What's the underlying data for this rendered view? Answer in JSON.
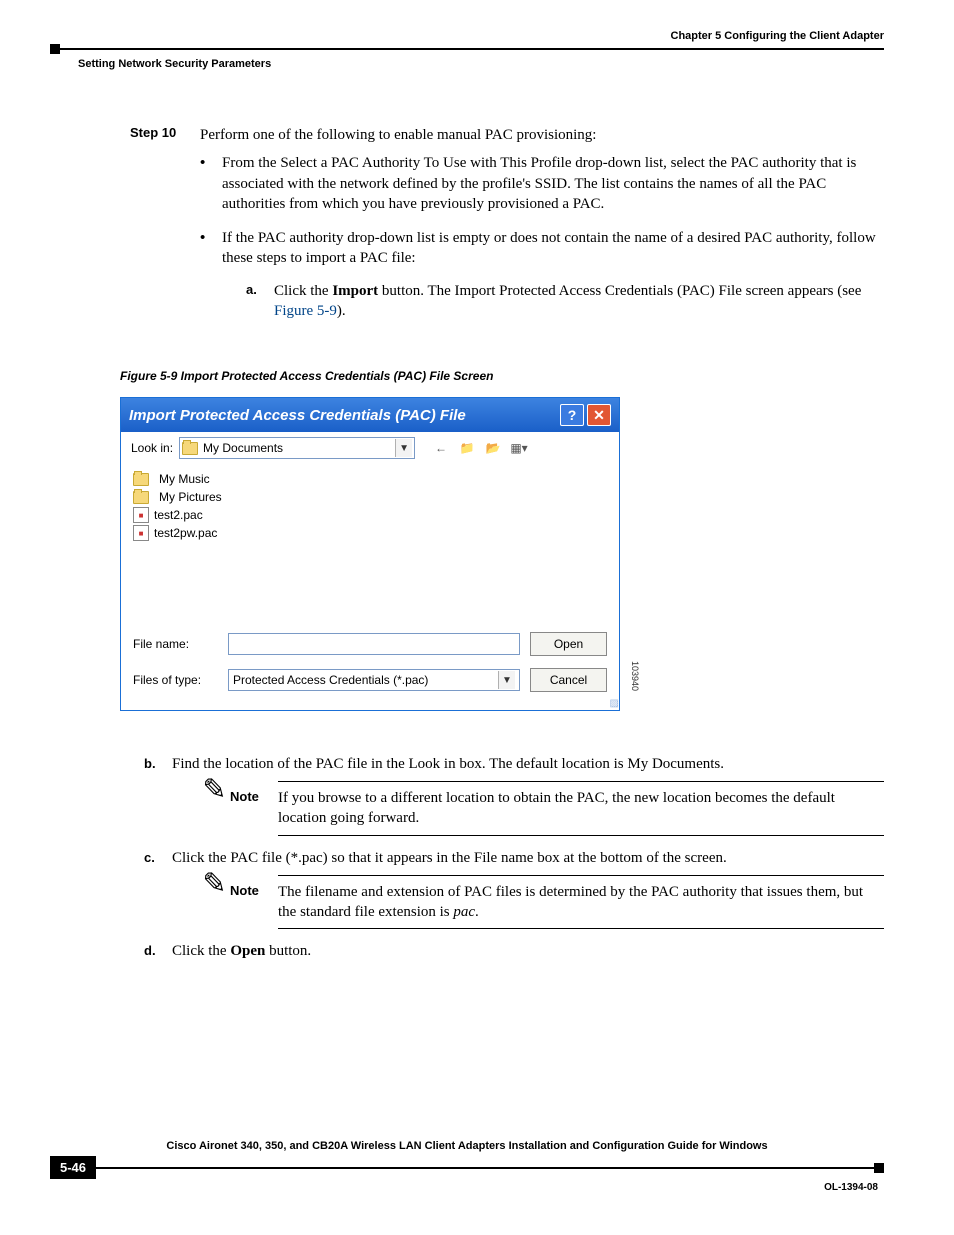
{
  "header": {
    "chapter": "Chapter 5      Configuring the Client Adapter",
    "section": "Setting Network Security Parameters"
  },
  "step": {
    "label": "Step 10",
    "intro": "Perform one of the following to enable manual PAC provisioning:",
    "bullets": [
      "From the Select a PAC Authority To Use with This Profile drop-down list, select the PAC authority that is associated with the network defined by the profile's SSID. The list contains the names of all the PAC authorities from which you have previously provisioned a PAC.",
      "If the PAC authority drop-down list is empty or does not contain the name of a desired PAC authority, follow these steps to import a PAC file:"
    ],
    "sub_a_pre": "Click the ",
    "sub_a_bold": "Import",
    "sub_a_post": " button. The Import Protected Access Credentials (PAC) File screen appears (see ",
    "sub_a_ref": "Figure 5-9",
    "sub_a_end": ")."
  },
  "figure": {
    "caption": "Figure 5-9    Import Protected Access Credentials (PAC) File Screen"
  },
  "dialog": {
    "title": "Import Protected Access Credentials (PAC) File",
    "lookin_label": "Look in:",
    "lookin_value": "My Documents",
    "files": [
      "My Music",
      "My Pictures",
      "test2.pac",
      "test2pw.pac"
    ],
    "filename_label": "File name:",
    "filetype_label": "Files of type:",
    "filetype_value": "Protected Access Credentials (*.pac)",
    "open": "Open",
    "cancel": "Cancel",
    "imgnum": "103940"
  },
  "after": {
    "b": "Find the location of the PAC file in the Look in box. The default location is My Documents.",
    "note_b": "If you browse to a different location to obtain the PAC, the new location becomes the default location going forward.",
    "c": "Click the PAC file (*.pac) so that it appears in the File name box at the bottom of the screen.",
    "note_c_pre": "The filename and extension of PAC files is determined by the PAC authority that issues them, but the standard file extension is ",
    "note_c_ital": "pac",
    "d_pre": "Click the ",
    "d_bold": "Open",
    "d_post": " button.",
    "note_label": "Note"
  },
  "footer": {
    "title": "Cisco Aironet 340, 350, and CB20A Wireless LAN Client Adapters Installation and Configuration Guide for Windows",
    "page": "5-46",
    "docid": "OL-1394-08"
  }
}
